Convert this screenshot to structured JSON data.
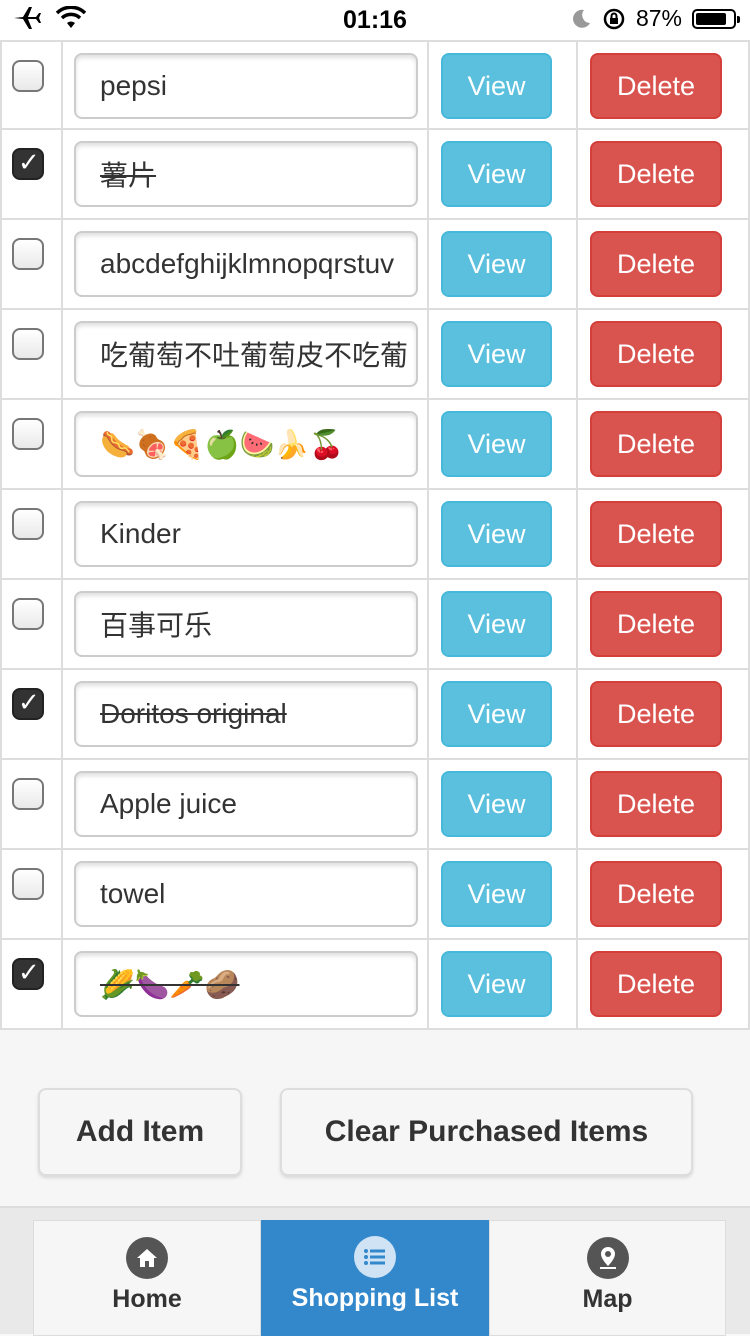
{
  "status_bar": {
    "time": "01:16",
    "battery": "87%",
    "battery_level": 0.87
  },
  "items": [
    {
      "name": "pepsi",
      "checked": false
    },
    {
      "name": "薯片",
      "checked": true
    },
    {
      "name": "abcdefghijklmnopqrstuv",
      "checked": false
    },
    {
      "name": "吃葡萄不吐葡萄皮不吃葡",
      "checked": false
    },
    {
      "name": "🌭🍖🍕🍏🍉🍌🍒",
      "checked": false
    },
    {
      "name": "Kinder",
      "checked": false
    },
    {
      "name": "百事可乐",
      "checked": false
    },
    {
      "name": "Doritos original",
      "checked": true
    },
    {
      "name": "Apple juice",
      "checked": false
    },
    {
      "name": "towel",
      "checked": false
    },
    {
      "name": "🌽🍆🥕🥔",
      "checked": true
    }
  ],
  "row_buttons": {
    "view": "View",
    "delete": "Delete"
  },
  "actions": {
    "add": "Add Item",
    "clear": "Clear Purchased Items"
  },
  "nav": {
    "home": "Home",
    "shopping": "Shopping List",
    "map": "Map",
    "active": "shopping",
    "active_color": "#3388cc"
  },
  "colors": {
    "view": "#5bc0de",
    "delete": "#d9534f"
  }
}
